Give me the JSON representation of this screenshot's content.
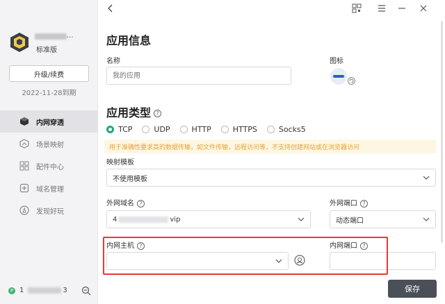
{
  "sidebar": {
    "plan": "标准版",
    "upgrade_label": "升级/续费",
    "expire_text": "2022-11-28到期",
    "items": [
      {
        "label": "内网穿透",
        "icon": "cube-icon",
        "active": true
      },
      {
        "label": "场景映射",
        "icon": "scene-icon",
        "active": false
      },
      {
        "label": "配件中心",
        "icon": "grid-icon",
        "active": false
      },
      {
        "label": "域名管理",
        "icon": "domain-icon",
        "active": false
      },
      {
        "label": "发现好玩",
        "icon": "compass-icon",
        "active": false
      }
    ],
    "footer_id_prefix": "1",
    "footer_id_suffix": "3"
  },
  "main": {
    "app_info_title": "应用信息",
    "name_label": "名称",
    "name_placeholder": "我的应用",
    "icon_label": "图标",
    "app_type_title": "应用类型",
    "types": [
      "TCP",
      "UDP",
      "HTTP",
      "HTTPS",
      "Socks5"
    ],
    "selected_type": "TCP",
    "notice": "用于准确性要求高的数据传输，如文件传输，远程访问等，不支持创建网站或在浏览器访问",
    "template_label": "映射模板",
    "template_value": "不使用模板",
    "ext_domain_label": "外网域名",
    "ext_domain_prefix": "4",
    "ext_domain_suffix": "vip",
    "ext_port_label": "外网端口",
    "ext_port_value": "动态端口",
    "int_host_label": "内网主机",
    "int_host_value": "",
    "int_port_label": "内网端口",
    "int_port_value": "",
    "save_label": "保存"
  },
  "colors": {
    "accent": "#1ea97c",
    "notice_bg": "#fdf6e3",
    "notice_text": "#e2a437",
    "highlight": "#e53935",
    "save_bg": "#4a4f58"
  }
}
